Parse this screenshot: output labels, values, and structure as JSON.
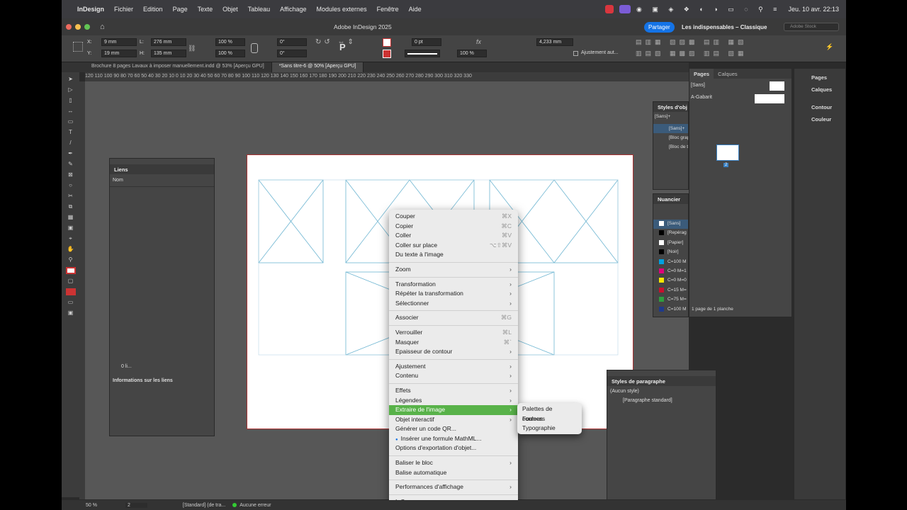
{
  "menubar": {
    "app": "InDesign",
    "items": [
      "Fichier",
      "Edition",
      "Page",
      "Texte",
      "Objet",
      "Tableau",
      "Affichage",
      "Modules externes",
      "Fenêtre",
      "Aide"
    ],
    "clock": "Jeu. 10 avr.  22:13"
  },
  "appbar": {
    "title": "Adobe InDesign 2025",
    "share": "Partager",
    "workspace": "Les indispensables – Classique",
    "stock": "Adobe Stock"
  },
  "control": {
    "x": "9 mm",
    "y": "19 mm",
    "w": "276 mm",
    "h": "135 mm",
    "scale_x": "100 %",
    "scale_y": "100 %",
    "angle": "0°",
    "shear": "0°",
    "stroke": "0 pt",
    "opacity": "100 %",
    "size": "4,233 mm",
    "fit": "Ajustement aut..."
  },
  "tabs": [
    "Brochure 8 pages Lavaux à imposer manuellement.indd @ 53% [Aperçu GPU]",
    "*Sans titre-6 @ 50% [Aperçu GPU]"
  ],
  "ruler": "120  110  100  90  80  70  60  50  40  30  20  10  0  10  20  30  40  50  60  70  80  90  100  110  120  130  140  150  160  170  180  190  200  210  220  230  240  250  260  270  280  290  300  310  320  330",
  "links": {
    "title": "Liens",
    "col": "Nom",
    "count": "0 li...",
    "info": "Informations sur les liens"
  },
  "context": [
    {
      "label": "Couper",
      "sc": "⌘X"
    },
    {
      "label": "Copier",
      "sc": "⌘C"
    },
    {
      "label": "Coller",
      "sc": "⌘V"
    },
    {
      "label": "Coller sur place",
      "sc": "⌥⇧⌘V"
    },
    {
      "label": "Du texte à l'image",
      "sc": ""
    },
    "sep",
    {
      "label": "Zoom",
      "sub": true
    },
    "sep",
    {
      "label": "Transformation",
      "sub": true
    },
    {
      "label": "Répéter la transformation",
      "sub": true
    },
    {
      "label": "Sélectionner",
      "sub": true
    },
    "sep",
    {
      "label": "Associer",
      "sc": "⌘G"
    },
    "sep",
    {
      "label": "Verrouiller",
      "sc": "⌘L"
    },
    {
      "label": "Masquer",
      "sc": "⌘`"
    },
    {
      "label": "Epaisseur de contour",
      "sub": true
    },
    "sep",
    {
      "label": "Ajustement",
      "sub": true
    },
    {
      "label": "Contenu",
      "sub": true
    },
    "sep",
    {
      "label": "Effets",
      "sub": true
    },
    {
      "label": "Légendes",
      "sub": true
    },
    {
      "label": "Extraire de l'image",
      "sub": true,
      "hl": true
    },
    {
      "label": "Objet interactif",
      "sub": true
    },
    {
      "label": "Générer un code QR...",
      "sc": ""
    },
    {
      "label": "Insérer une formule MathML...",
      "sc": "",
      "dot": true
    },
    {
      "label": "Options d'exportation d'objet...",
      "sc": ""
    },
    "sep",
    {
      "label": "Baliser le bloc",
      "sub": true
    },
    {
      "label": "Balise automatique",
      "sc": ""
    },
    "sep",
    {
      "label": "Performances d'affichage",
      "sub": true
    },
    "sep",
    {
      "label": "InCopy",
      "sub": true
    }
  ],
  "submenu": [
    "Palettes de couleurs",
    "Formes",
    "Typographie"
  ],
  "pages": {
    "tab1": "Pages",
    "tab2": "Calques",
    "none": "[Sans]",
    "gabarit": "A-Gabarit",
    "num": "2",
    "footer": "1 page de 1 planche"
  },
  "objstyles": {
    "title": "Styles d'obj",
    "items": [
      "[Sans]+",
      "[Sans]+",
      "[Bloc grap",
      "[Bloc de t"
    ]
  },
  "nuancier": {
    "title": "Nuancier",
    "items": [
      {
        "n": "[Sans]",
        "c": "#ffffff"
      },
      {
        "n": "[Repérag",
        "c": "#000000"
      },
      {
        "n": "[Papier]",
        "c": "#ffffff"
      },
      {
        "n": "[Noir]",
        "c": "#000000"
      },
      {
        "n": "C=100 M",
        "c": "#00a0e0"
      },
      {
        "n": "C=0 M=1",
        "c": "#e0007a"
      },
      {
        "n": "C=0 M=0",
        "c": "#f5e600"
      },
      {
        "n": "C=15 M=",
        "c": "#c8102e"
      },
      {
        "n": "C=75 M=",
        "c": "#2e9e3e"
      },
      {
        "n": "C=100 M",
        "c": "#1f3a8a"
      }
    ]
  },
  "rightpanel": [
    "Pages",
    "Calques",
    "Contour",
    "Couleur"
  ],
  "parastyles": {
    "title": "Styles de paragraphe",
    "none": "(Aucun style)",
    "std": "[Paragraphe standard]"
  },
  "status": {
    "zoom": "50 %",
    "page": "2",
    "style": "[Standard] (de tra...",
    "errors": "Aucune erreur"
  }
}
